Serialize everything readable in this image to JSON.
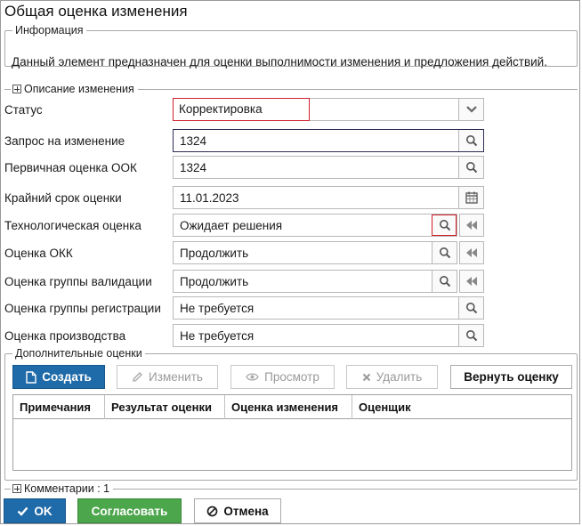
{
  "window": {
    "title": "Общая оценка изменения"
  },
  "info": {
    "legend": "Информация",
    "text": "Данный элемент предназначен для оценки выполнимости изменения и предложения действий."
  },
  "description_section": {
    "label": "Описание изменения"
  },
  "fields": {
    "status": {
      "label": "Статус",
      "value": "Корректировка"
    },
    "change_request": {
      "label": "Запрос на изменение",
      "value": "1324"
    },
    "primary_eval": {
      "label": "Первичная оценка ООК",
      "value": "1324"
    },
    "deadline": {
      "label": "Крайний срок оценки",
      "value": "11.01.2023"
    },
    "tech_eval": {
      "label": "Технологическая оценка",
      "value": "Ожидает решения"
    },
    "okk_eval": {
      "label": "Оценка ОКК",
      "value": "Продолжить"
    },
    "validation_eval": {
      "label": "Оценка группы валидации",
      "value": "Продолжить"
    },
    "registration_eval": {
      "label": "Оценка группы регистрации",
      "value": "Не требуется"
    },
    "production_eval": {
      "label": "Оценка производства",
      "value": "Не требуется"
    }
  },
  "additional": {
    "legend": "Дополнительные оценки",
    "buttons": {
      "create": "Создать",
      "edit": "Изменить",
      "view": "Просмотр",
      "delete": "Удалить",
      "return": "Вернуть оценку"
    },
    "columns": [
      "Примечания",
      "Результат оценки",
      "Оценка изменения",
      "Оценщик"
    ]
  },
  "comments_section": {
    "label": "Комментарии : 1"
  },
  "footer": {
    "ok": "OK",
    "approve": "Согласовать",
    "cancel": "Отмена"
  },
  "colors": {
    "primary": "#1f6aa8",
    "approve": "#4ca64c",
    "highlight": "#d0202a"
  },
  "icons": {
    "dropdown": "chevron-down-icon",
    "search": "search-icon",
    "calendar": "calendar-icon",
    "rewind": "rewind-icon"
  }
}
